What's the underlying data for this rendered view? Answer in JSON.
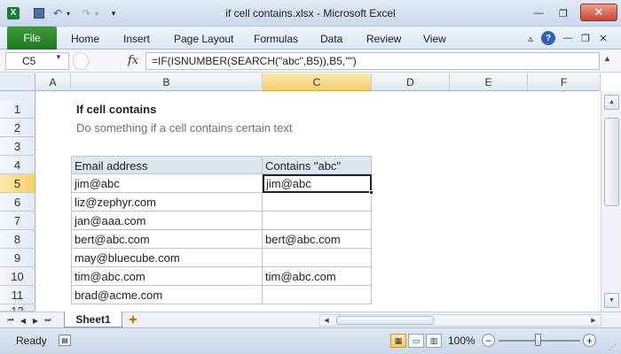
{
  "window": {
    "title": "if cell contains.xlsx - Microsoft Excel",
    "minimize_glyph": "—",
    "restore_glyph": "❐",
    "close_glyph": "✕"
  },
  "quick_access": {
    "save_glyph": "💾",
    "undo_glyph": "↶",
    "redo_glyph": "↷",
    "dropdown_glyph": "▾",
    "customize_glyph": "▾"
  },
  "ribbon": {
    "file_label": "File",
    "tabs": [
      "Home",
      "Insert",
      "Page Layout",
      "Formulas",
      "Data",
      "Review",
      "View"
    ],
    "minimize_glyph": "▵",
    "help_glyph": "?",
    "win_min_glyph": "—",
    "win_restore_glyph": "❐",
    "win_close_glyph": "✕"
  },
  "formula_bar": {
    "name_box": "C5",
    "fx_label": "fx",
    "formula": "=IF(ISNUMBER(SEARCH(\"abc\",B5)),B5,\"\")"
  },
  "grid": {
    "columns": [
      "A",
      "B",
      "C",
      "D",
      "E",
      "F"
    ],
    "rows": [
      "1",
      "2",
      "3",
      "4",
      "5",
      "6",
      "7",
      "8",
      "9",
      "10",
      "11",
      "12"
    ],
    "active_cell": "C5",
    "title": "If cell contains",
    "subtitle": "Do something if a cell contains certain text",
    "table": {
      "headers": [
        "Email address",
        "Contains \"abc\""
      ],
      "rows": [
        [
          "jim@abc",
          "jim@abc"
        ],
        [
          "liz@zephyr.com",
          ""
        ],
        [
          "jan@aaa.com",
          ""
        ],
        [
          "bert@abc.com",
          "bert@abc.com"
        ],
        [
          "may@bluecube.com",
          ""
        ],
        [
          "tim@abc.com",
          "tim@abc.com"
        ],
        [
          "brad@acme.com",
          ""
        ]
      ]
    }
  },
  "sheets": {
    "tabs": [
      "Sheet1"
    ],
    "active": "Sheet1"
  },
  "status": {
    "ready": "Ready",
    "zoom": "100%",
    "zoom_level": 0.5,
    "zoom_minus": "−",
    "zoom_plus": "+"
  },
  "colors": {
    "file_tab": "#217a21",
    "header_fill": "#dce6f1",
    "active_header": "#f6cf6a"
  },
  "icons": {
    "save": "save-icon",
    "undo": "undo-icon",
    "redo": "redo-icon",
    "help": "help-icon",
    "macro": "macro-record-icon",
    "new_sheet": "insert-sheet-icon"
  }
}
